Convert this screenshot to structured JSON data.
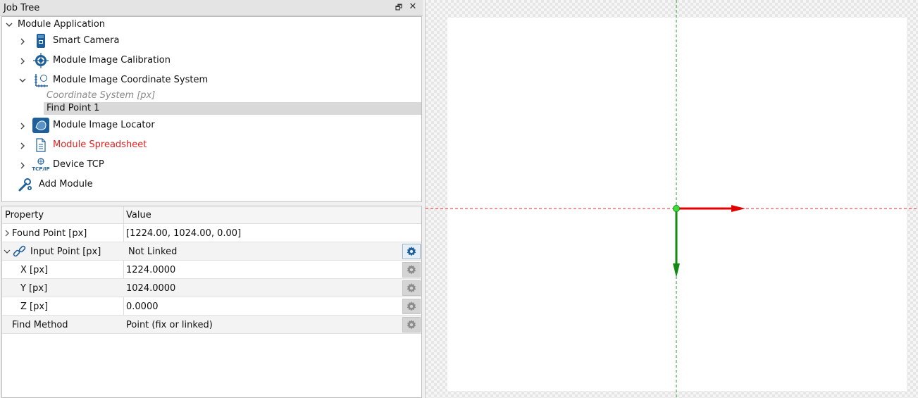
{
  "job_tree": {
    "title": "Job Tree",
    "float_icon": "restore-window-icon",
    "close_icon": "close-icon",
    "items": [
      {
        "label": "Module Application",
        "icon": "none"
      },
      {
        "label": "Smart Camera",
        "icon": "smart-camera-icon"
      },
      {
        "label": "Module Image Calibration",
        "icon": "calibration-target-icon"
      },
      {
        "label": "Module Image Coordinate System",
        "icon": "coordinate-system-icon"
      },
      {
        "label": "Coordinate System [px]",
        "icon": "none"
      },
      {
        "label": "Find Point 1",
        "icon": "none"
      },
      {
        "label": "Module Image Locator",
        "icon": "image-locator-icon"
      },
      {
        "label": "Module Spreadsheet",
        "icon": "spreadsheet-icon",
        "color": "#e02020"
      },
      {
        "label": "Device TCP",
        "icon": "tcp-ip-icon",
        "icon_text": "TCP/IP"
      },
      {
        "label": "Add Module",
        "icon": "wrench-gear-icon"
      }
    ]
  },
  "properties": {
    "header_property": "Property",
    "header_value": "Value",
    "rows": [
      {
        "name": "Found Point [px]",
        "value": "[1224.00, 1024.00, 0.00]"
      },
      {
        "name": "Input Point [px]",
        "value": "Not Linked"
      },
      {
        "name": "X [px]",
        "value": "1224.0000"
      },
      {
        "name": "Y [px]",
        "value": "1024.0000"
      },
      {
        "name": "Z [px]",
        "value": "0.0000"
      },
      {
        "name": "Find Method",
        "value": "Point (fix or linked)"
      }
    ]
  },
  "colors": {
    "accent_blue": "#1f5f99",
    "x_axis": "#e00000",
    "y_axis": "#118a11",
    "origin": "#39e039"
  }
}
